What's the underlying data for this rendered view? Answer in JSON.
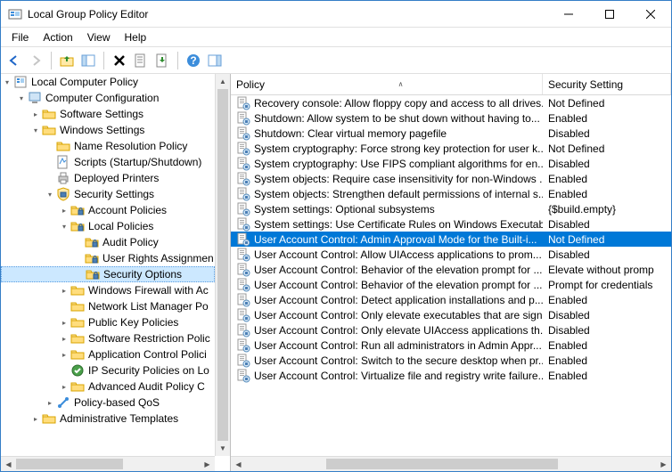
{
  "window": {
    "title": "Local Group Policy Editor"
  },
  "menubar": [
    "File",
    "Action",
    "View",
    "Help"
  ],
  "toolbar": [
    {
      "name": "back-button",
      "icon": "arrow-left",
      "disabled": false
    },
    {
      "name": "forward-button",
      "icon": "arrow-right",
      "disabled": true
    },
    {
      "sep": true
    },
    {
      "name": "up-button",
      "icon": "folder-up"
    },
    {
      "name": "show-hide-tree-button",
      "icon": "layout"
    },
    {
      "sep": true
    },
    {
      "name": "delete-button",
      "icon": "x"
    },
    {
      "name": "properties-button",
      "icon": "properties"
    },
    {
      "name": "export-list-button",
      "icon": "export"
    },
    {
      "sep": true
    },
    {
      "name": "help-button",
      "icon": "help"
    },
    {
      "name": "show-hide-action-pane-button",
      "icon": "action-pane"
    }
  ],
  "tree": {
    "root": {
      "label": "Local Computer Policy",
      "icon": "policy",
      "expanded": true,
      "children": [
        {
          "label": "Computer Configuration",
          "icon": "computer",
          "expanded": true,
          "children": [
            {
              "label": "Software Settings",
              "icon": "folder",
              "expanded": false,
              "hasChildren": true
            },
            {
              "label": "Windows Settings",
              "icon": "folder",
              "expanded": true,
              "children": [
                {
                  "label": "Name Resolution Policy",
                  "icon": "folder"
                },
                {
                  "label": "Scripts (Startup/Shutdown)",
                  "icon": "script"
                },
                {
                  "label": "Deployed Printers",
                  "icon": "printer"
                },
                {
                  "label": "Security Settings",
                  "icon": "security",
                  "expanded": true,
                  "children": [
                    {
                      "label": "Account Policies",
                      "icon": "folder-lock",
                      "hasChildren": true
                    },
                    {
                      "label": "Local Policies",
                      "icon": "folder-lock",
                      "expanded": true,
                      "children": [
                        {
                          "label": "Audit Policy",
                          "icon": "folder-lock"
                        },
                        {
                          "label": "User Rights Assignment",
                          "icon": "folder-lock",
                          "truncatedLabel": "User Rights Assignmen"
                        },
                        {
                          "label": "Security Options",
                          "icon": "folder-lock",
                          "selected": true
                        }
                      ]
                    },
                    {
                      "label": "Windows Firewall with Advanced Security",
                      "icon": "folder",
                      "truncatedLabel": "Windows Firewall with Ac",
                      "hasChildren": true
                    },
                    {
                      "label": "Network List Manager Policies",
                      "icon": "folder",
                      "truncatedLabel": "Network List Manager Po"
                    },
                    {
                      "label": "Public Key Policies",
                      "icon": "folder",
                      "hasChildren": true
                    },
                    {
                      "label": "Software Restriction Policies",
                      "icon": "folder",
                      "truncatedLabel": "Software Restriction Polic",
                      "hasChildren": true
                    },
                    {
                      "label": "Application Control Policies",
                      "icon": "folder",
                      "truncatedLabel": "Application Control Polici",
                      "hasChildren": true
                    },
                    {
                      "label": "IP Security Policies on Local Computer",
                      "icon": "ipsec",
                      "truncatedLabel": "IP Security Policies on Lo"
                    },
                    {
                      "label": "Advanced Audit Policy Configuration",
                      "icon": "folder",
                      "truncatedLabel": "Advanced Audit Policy C",
                      "hasChildren": true
                    }
                  ]
                },
                {
                  "label": "Policy-based QoS",
                  "icon": "qos",
                  "hasChildren": true
                }
              ]
            },
            {
              "label": "Administrative Templates",
              "icon": "folder",
              "hasChildren": true
            }
          ]
        }
      ]
    }
  },
  "list": {
    "columns": [
      "Policy",
      "Security Setting"
    ],
    "sort_col": 0,
    "rows": [
      {
        "policy": "Recovery console: Allow floppy copy and access to all drives...",
        "setting": "Not Defined"
      },
      {
        "policy": "Shutdown: Allow system to be shut down without having to...",
        "setting": "Enabled"
      },
      {
        "policy": "Shutdown: Clear virtual memory pagefile",
        "setting": "Disabled"
      },
      {
        "policy": "System cryptography: Force strong key protection for user k...",
        "setting": "Not Defined"
      },
      {
        "policy": "System cryptography: Use FIPS compliant algorithms for en...",
        "setting": "Disabled"
      },
      {
        "policy": "System objects: Require case insensitivity for non-Windows ...",
        "setting": "Enabled"
      },
      {
        "policy": "System objects: Strengthen default permissions of internal s...",
        "setting": "Enabled"
      },
      {
        "policy": "System settings: Optional subsystems",
        "setting": "{$build.empty}"
      },
      {
        "policy": "System settings: Use Certificate Rules on Windows Executabl...",
        "setting": "Disabled"
      },
      {
        "policy": "User Account Control: Admin Approval Mode for the Built-i...",
        "setting": "Not Defined",
        "selected": true
      },
      {
        "policy": "User Account Control: Allow UIAccess applications to prom...",
        "setting": "Disabled"
      },
      {
        "policy": "User Account Control: Behavior of the elevation prompt for ...",
        "setting": "Elevate without prompting",
        "settingTrunc": "Elevate without promp"
      },
      {
        "policy": "User Account Control: Behavior of the elevation prompt for ...",
        "setting": "Prompt for credentials"
      },
      {
        "policy": "User Account Control: Detect application installations and p...",
        "setting": "Enabled"
      },
      {
        "policy": "User Account Control: Only elevate executables that are sign...",
        "setting": "Disabled"
      },
      {
        "policy": "User Account Control: Only elevate UIAccess applications th...",
        "setting": "Disabled"
      },
      {
        "policy": "User Account Control: Run all administrators in Admin Appr...",
        "setting": "Enabled"
      },
      {
        "policy": "User Account Control: Switch to the secure desktop when pr...",
        "setting": "Enabled"
      },
      {
        "policy": "User Account Control: Virtualize file and registry write failure...",
        "setting": "Enabled"
      }
    ]
  }
}
